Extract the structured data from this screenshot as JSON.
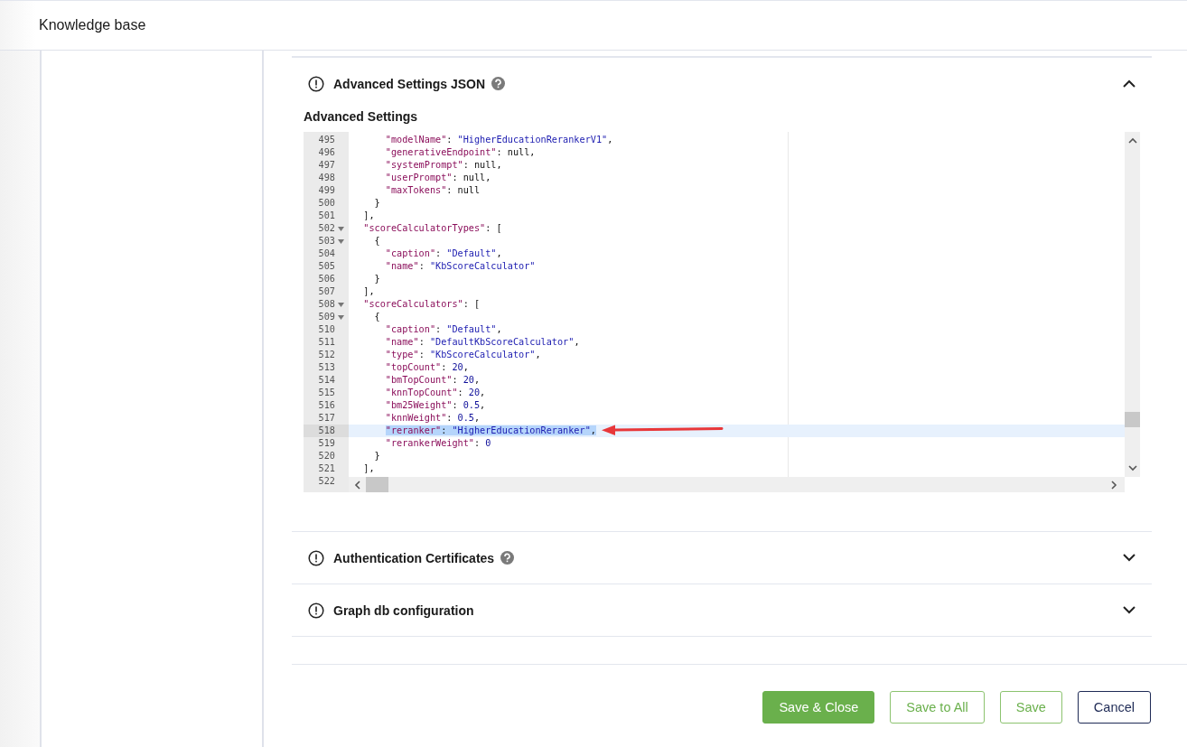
{
  "header": {
    "title": "Knowledge base"
  },
  "sections": [
    {
      "title": "Advanced Settings JSON",
      "help": true,
      "expanded": true,
      "field_label": "Advanced Settings",
      "editor": {
        "lines": [
          {
            "number": "495",
            "foldable": false,
            "selected": false,
            "text": "      \"modelName\": \"HigherEducationRerankerV1\","
          },
          {
            "number": "496",
            "foldable": false,
            "selected": false,
            "text": "      \"generativeEndpoint\": null,"
          },
          {
            "number": "497",
            "foldable": false,
            "selected": false,
            "text": "      \"systemPrompt\": null,"
          },
          {
            "number": "498",
            "foldable": false,
            "selected": false,
            "text": "      \"userPrompt\": null,"
          },
          {
            "number": "499",
            "foldable": false,
            "selected": false,
            "text": "      \"maxTokens\": null"
          },
          {
            "number": "500",
            "foldable": false,
            "selected": false,
            "text": "    }"
          },
          {
            "number": "501",
            "foldable": false,
            "selected": false,
            "text": "  ],"
          },
          {
            "number": "502",
            "foldable": true,
            "selected": false,
            "text": "  \"scoreCalculatorTypes\": ["
          },
          {
            "number": "503",
            "foldable": true,
            "selected": false,
            "text": "    {"
          },
          {
            "number": "504",
            "foldable": false,
            "selected": false,
            "text": "      \"caption\": \"Default\","
          },
          {
            "number": "505",
            "foldable": false,
            "selected": false,
            "text": "      \"name\": \"KbScoreCalculator\""
          },
          {
            "number": "506",
            "foldable": false,
            "selected": false,
            "text": "    }"
          },
          {
            "number": "507",
            "foldable": false,
            "selected": false,
            "text": "  ],"
          },
          {
            "number": "508",
            "foldable": true,
            "selected": false,
            "text": "  \"scoreCalculators\": ["
          },
          {
            "number": "509",
            "foldable": true,
            "selected": false,
            "text": "    {"
          },
          {
            "number": "510",
            "foldable": false,
            "selected": false,
            "text": "      \"caption\": \"Default\","
          },
          {
            "number": "511",
            "foldable": false,
            "selected": false,
            "text": "      \"name\": \"DefaultKbScoreCalculator\","
          },
          {
            "number": "512",
            "foldable": false,
            "selected": false,
            "text": "      \"type\": \"KbScoreCalculator\","
          },
          {
            "number": "513",
            "foldable": false,
            "selected": false,
            "text": "      \"topCount\": 20,"
          },
          {
            "number": "514",
            "foldable": false,
            "selected": false,
            "text": "      \"bmTopCount\": 20,"
          },
          {
            "number": "515",
            "foldable": false,
            "selected": false,
            "text": "      \"knnTopCount\": 20,"
          },
          {
            "number": "516",
            "foldable": false,
            "selected": false,
            "text": "      \"bm25Weight\": 0.5,"
          },
          {
            "number": "517",
            "foldable": false,
            "selected": false,
            "text": "      \"knnWeight\": 0.5,"
          },
          {
            "number": "518",
            "foldable": false,
            "selected": true,
            "text": "      \"reranker\": \"HigherEducationReranker\","
          },
          {
            "number": "519",
            "foldable": false,
            "selected": false,
            "text": "      \"rerankerWeight\": 0"
          },
          {
            "number": "520",
            "foldable": false,
            "selected": false,
            "text": "    }"
          },
          {
            "number": "521",
            "foldable": false,
            "selected": false,
            "text": "  ],"
          },
          {
            "number": "522",
            "foldable": false,
            "selected": false
          }
        ]
      }
    },
    {
      "title": "Authentication Certificates",
      "help": true,
      "expanded": false
    },
    {
      "title": "Graph db configuration",
      "help": false,
      "expanded": false
    }
  ],
  "buttons": [
    {
      "label": "Save & Close",
      "kind": "primary"
    },
    {
      "label": "Save to All",
      "kind": "secondary"
    },
    {
      "label": "Save",
      "kind": "secondary"
    },
    {
      "label": "Cancel",
      "kind": "neutral"
    }
  ]
}
